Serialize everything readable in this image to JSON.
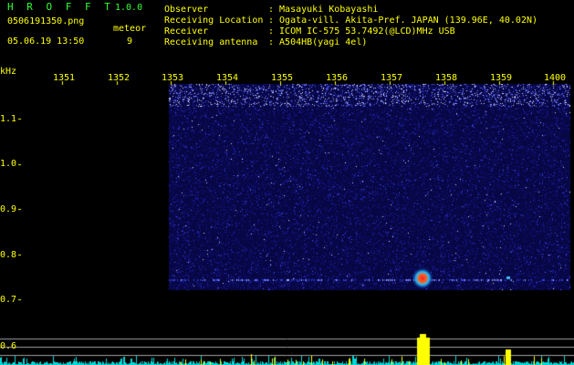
{
  "header": {
    "app_title": "H R O F F T",
    "version": "1.0.0",
    "filename": "0506191350.png",
    "meteor_label": "meteor",
    "datetime": "05.06.19 13:50",
    "meteor_count": "9"
  },
  "info": [
    {
      "key": "Observer",
      "value": ": Masayuki Kobayashi"
    },
    {
      "key": "Receiving Location",
      "value": ": Ogata-vill. Akita-Pref. JAPAN (139.96E, 40.02N)"
    },
    {
      "key": "Receiver",
      "value": ": ICOM IC-575 53.7492(@LCD)MHz USB"
    },
    {
      "key": "Receiving antenna",
      "value": ": A504HB(yagi 4el)"
    }
  ],
  "axes": {
    "y_unit": "kHz",
    "x_ticks": [
      "1351",
      "1352",
      "1353",
      "1354",
      "1355",
      "1356",
      "1357",
      "1358",
      "1359",
      "1400"
    ],
    "y_ticks": [
      "1.1",
      "1.0",
      "0.9",
      "0.8",
      "0.7",
      "0.6"
    ]
  },
  "colors": {
    "text_green": "#33ff33",
    "text_yellow": "#ffff00",
    "spectrum_bg": "#0a0a60",
    "signal_red": "#ff2020",
    "level_cyan": "#00e0e0"
  }
}
